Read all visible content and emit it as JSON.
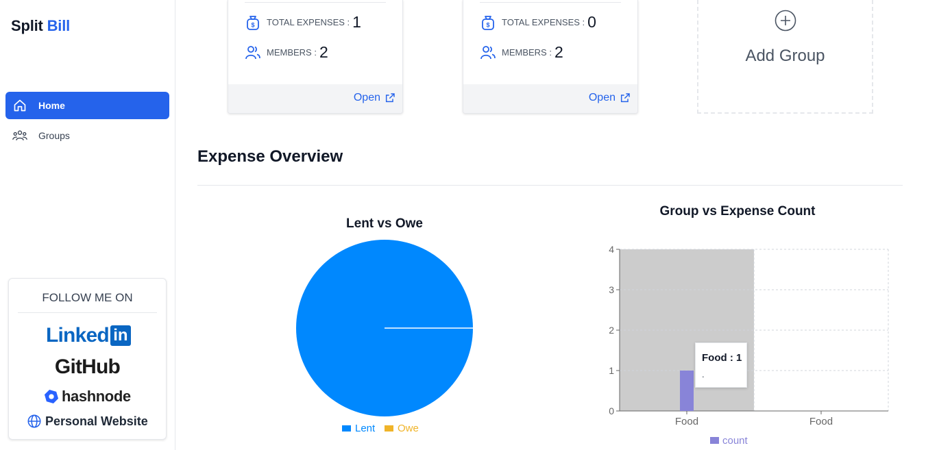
{
  "app": {
    "brand_part1": "Split",
    "brand_part2": "Bill"
  },
  "sidebar": {
    "items": [
      {
        "label": "Home",
        "icon": "home-icon",
        "active": true
      },
      {
        "label": "Groups",
        "icon": "users-icon",
        "active": false
      }
    ],
    "follow": {
      "title": "FOLLOW ME ON",
      "linkedin_text": "Linked",
      "linkedin_box": "in",
      "github": "GitHub",
      "hashnode": "hashnode",
      "website": "Personal Website"
    }
  },
  "cards": [
    {
      "total_expenses_label": "TOTAL EXPENSES :",
      "total_expenses": "1",
      "members_label": "MEMBERS :",
      "members": "2",
      "open_label": "Open"
    },
    {
      "total_expenses_label": "TOTAL EXPENSES :",
      "total_expenses": "0",
      "members_label": "MEMBERS :",
      "members": "2",
      "open_label": "Open"
    }
  ],
  "add_group": {
    "label": "Add Group"
  },
  "overview": {
    "title": "Expense Overview"
  },
  "colors": {
    "accent": "#2563eb",
    "lent": "#0088fe",
    "owe": "#f0b429",
    "count": "#8884d8"
  },
  "chart_data": [
    {
      "type": "pie",
      "title": "Lent vs Owe",
      "labels": [
        "Lent",
        "Owe"
      ],
      "values": [
        1,
        0
      ],
      "legend": "bottom"
    },
    {
      "type": "bar",
      "title": "Group vs Expense Count",
      "categories": [
        "Food",
        "Food"
      ],
      "series": [
        {
          "name": "count",
          "values": [
            1,
            0
          ]
        }
      ],
      "ylim": [
        0,
        4
      ],
      "yticks": [
        0,
        1,
        2,
        3,
        4
      ],
      "grid": true,
      "legend": "bottom",
      "tooltip": {
        "title": "Food : 1",
        "body": "."
      }
    }
  ]
}
